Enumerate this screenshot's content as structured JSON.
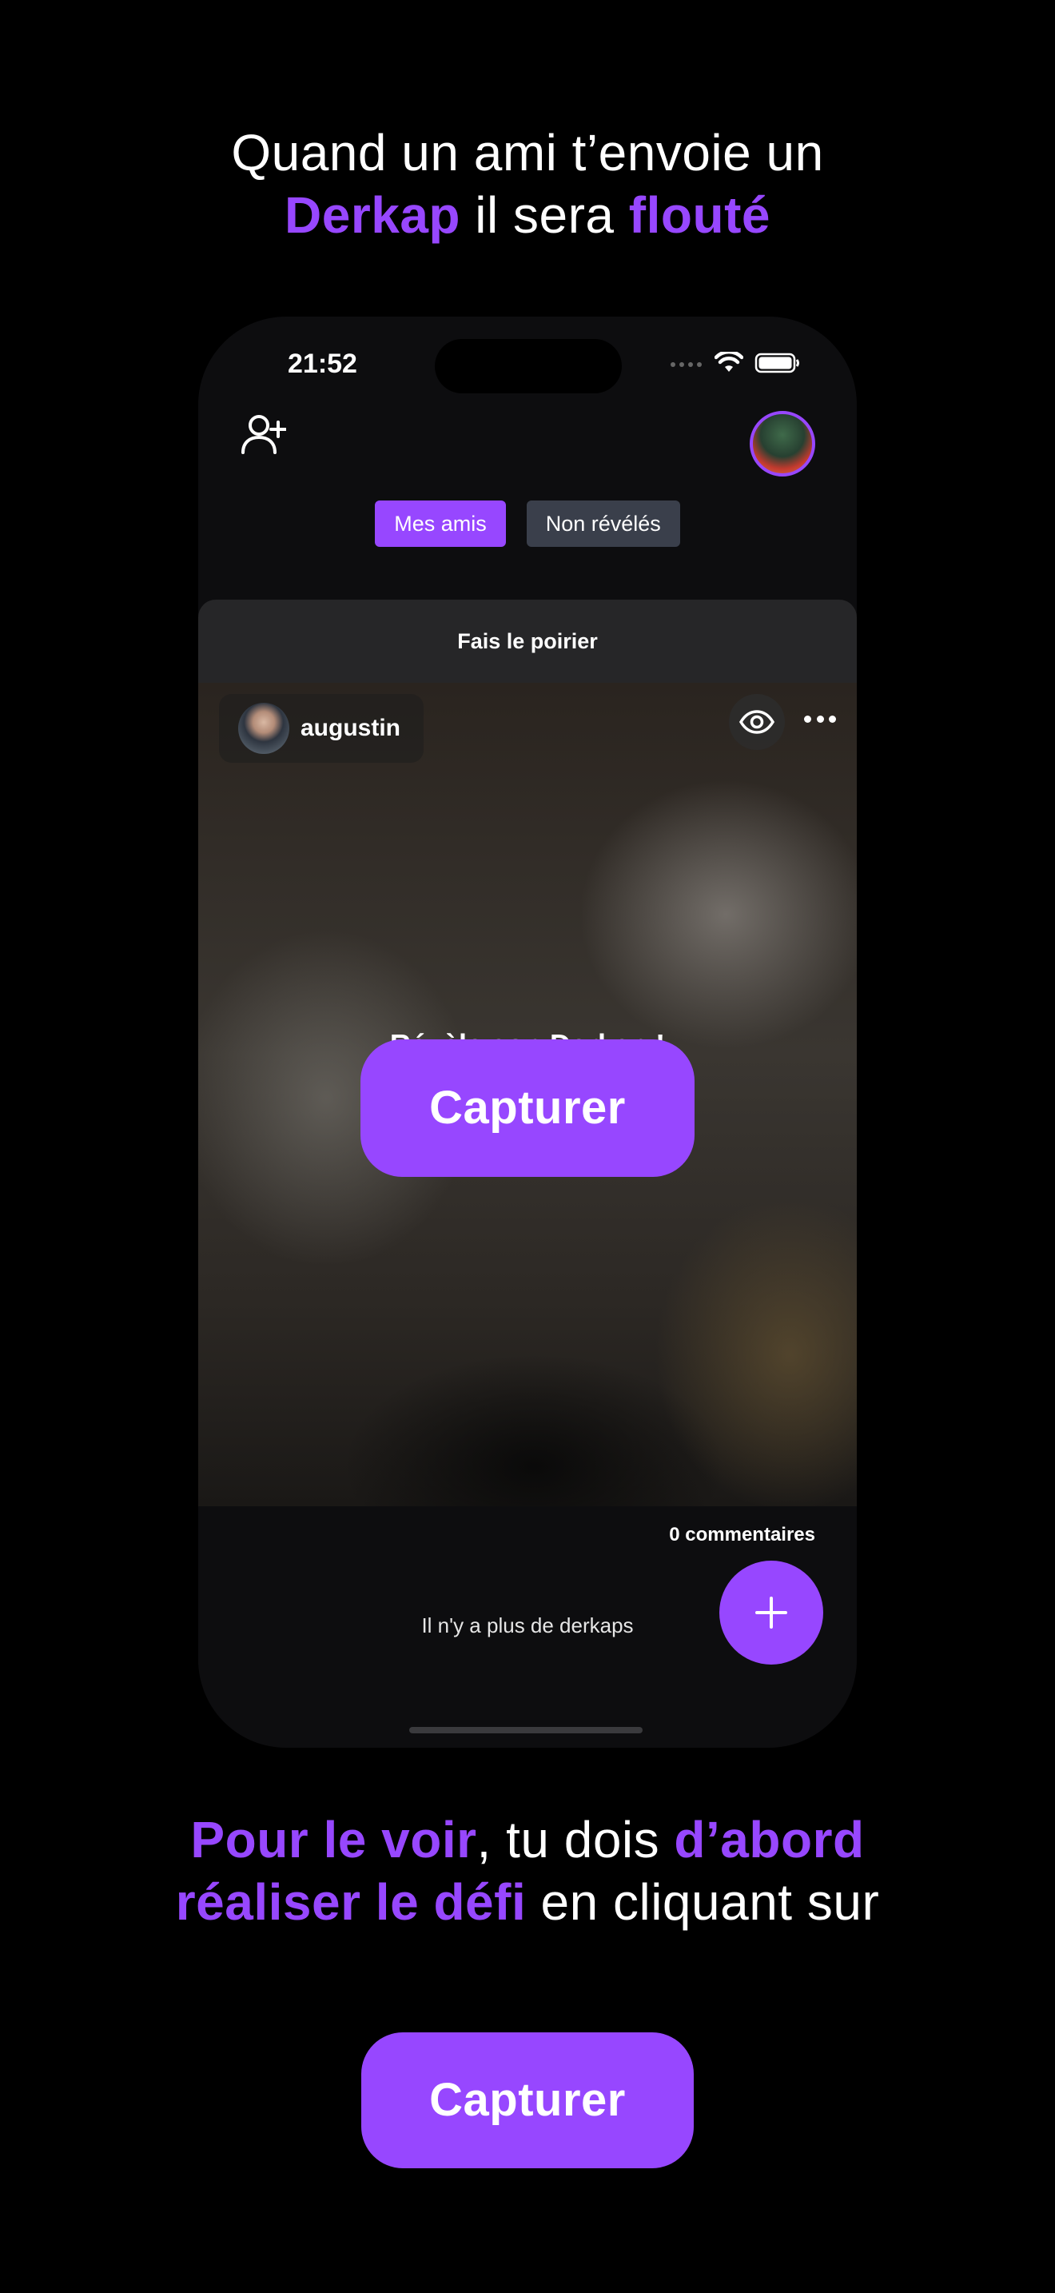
{
  "headline_top": {
    "line1": "Quand un ami t’envoie un",
    "word_app": "Derkap",
    "word_mid": " il sera ",
    "word_blur": "flouté"
  },
  "status_bar": {
    "time": "21:52"
  },
  "header": {
    "add_friend_icon": "user-plus-icon",
    "avatar_icon": "profile-avatar"
  },
  "tabs": [
    {
      "label": "Mes amis",
      "active": true
    },
    {
      "label": "Non révélés",
      "active": false
    }
  ],
  "post": {
    "challenge": "Fais le poirier",
    "username": "augustin",
    "reveal_text": "Révèle son Derkap !",
    "capture_label": "Capturer",
    "comments": "0 commentaires"
  },
  "feed": {
    "empty_text": "Il n'y a plus de derkaps"
  },
  "headline_bottom": {
    "p1": "Pour le voir",
    "p2": ", tu dois ",
    "p3": "d’abord",
    "p4": "réaliser le défi",
    "p5": " en cliquant sur"
  },
  "bottom_button": {
    "label": "Capturer"
  },
  "colors": {
    "accent": "#9747FF",
    "tab_inactive": "#3A3F4B",
    "background": "#000000"
  }
}
